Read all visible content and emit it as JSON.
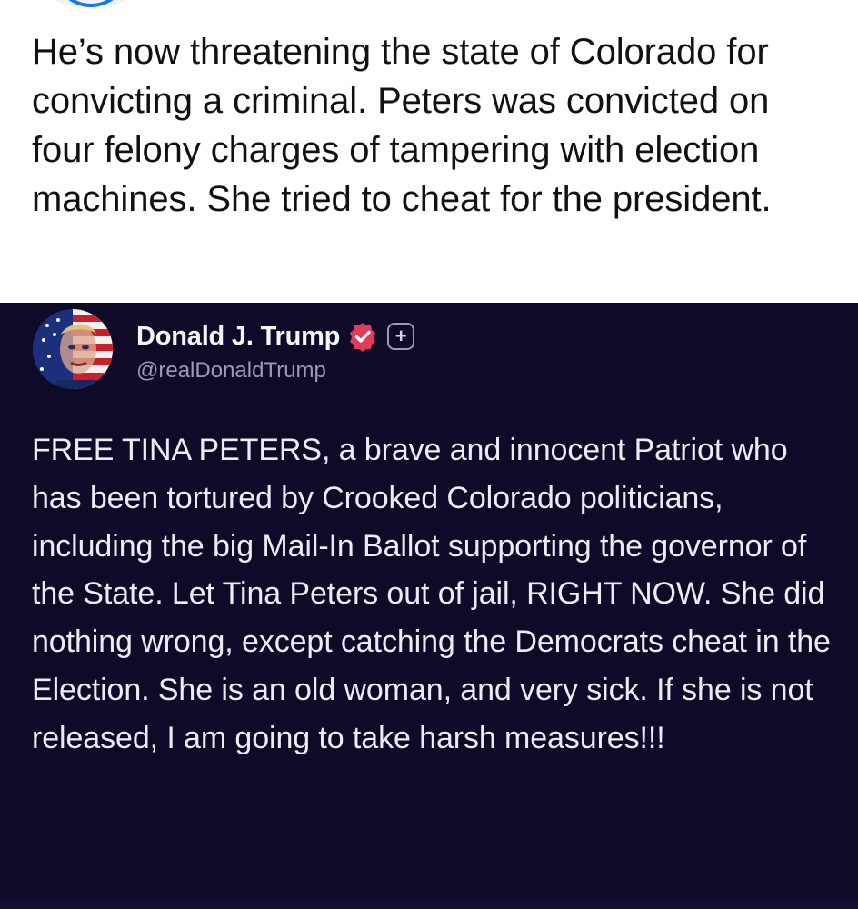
{
  "post": {
    "text": "He’s now threatening the state of Colorado for convicting a criminal.  Peters was convicted on four felony charges of tampering with election machines. She tried to cheat for the president."
  },
  "shared_status": {
    "display_name": "Donald J. Trump",
    "handle": "@realDonaldTrump",
    "verified_icon": "verified-check-icon",
    "plus_label": "+",
    "accent_color": "#e23c5c",
    "background_color": "#0f0a28",
    "text": "FREE TINA PETERS, a brave and innocent Patriot who has been tortured by Crooked Colorado politicians, including the big Mail-In Ballot supporting the governor of the State. Let Tina Peters out of jail, RIGHT NOW. She did nothing wrong, except catching the Democrats cheat in the Election. She is an old woman, and very sick. If she is not released, I am going to take harsh measures!!!"
  }
}
